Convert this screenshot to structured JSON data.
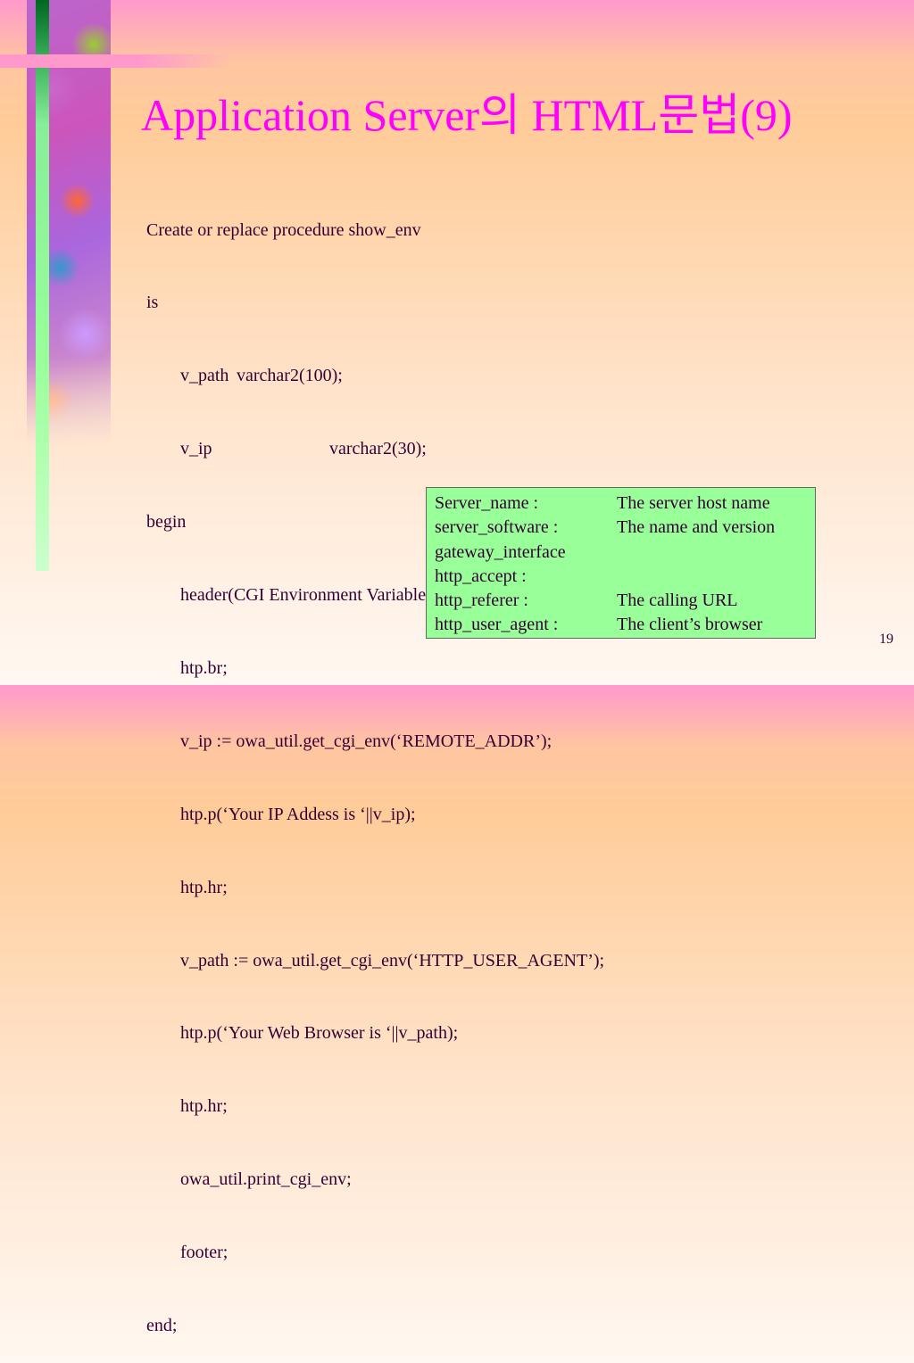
{
  "slide": {
    "title": "Application Server의 HTML문법(9)",
    "page_number": "19",
    "code_lines": [
      {
        "text": "Create or replace procedure show_env",
        "indent": false
      },
      {
        "text": "is",
        "indent": false
      },
      {
        "text": "v_path",
        "col2": "varchar2(100);",
        "indent": true
      },
      {
        "text": "v_ip",
        "col2": "varchar2(30);",
        "indent": true
      },
      {
        "text": "begin",
        "indent": false
      },
      {
        "text": "header(CGI Environment Variables’);",
        "indent": true
      },
      {
        "text": "htp.br;",
        "indent": true
      },
      {
        "text": "v_ip := owa_util.get_cgi_env(‘REMOTE_ADDR’);",
        "indent": true
      },
      {
        "text": "htp.p(‘Your IP Addess is ‘||v_ip);",
        "indent": true
      },
      {
        "text": "htp.hr;",
        "indent": true
      },
      {
        "text": "v_path := owa_util.get_cgi_env(‘HTTP_USER_AGENT’);",
        "indent": true
      },
      {
        "text": "htp.p(‘Your Web Browser is ‘||v_path);",
        "indent": true
      },
      {
        "text": "htp.hr;",
        "indent": true
      },
      {
        "text": "owa_util.print_cgi_env;",
        "indent": true
      },
      {
        "text": "footer;",
        "indent": true
      },
      {
        "text": "end;",
        "indent": false
      }
    ],
    "env_box": [
      {
        "key": "Server_name :",
        "desc": "The server host name"
      },
      {
        "key": "server_software :",
        "desc": "The name and version"
      },
      {
        "key": "gateway_interface",
        "desc": ""
      },
      {
        "key": "http_accept :",
        "desc": ""
      },
      {
        "key": "http_referer :",
        "desc": "The calling URL"
      },
      {
        "key": "http_user_agent :",
        "desc": "The client’s browser"
      }
    ]
  }
}
